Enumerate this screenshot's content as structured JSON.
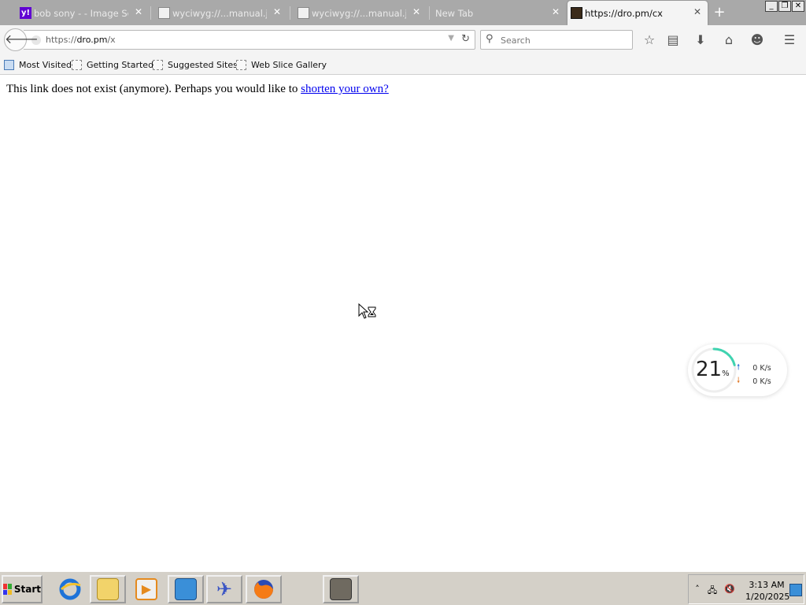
{
  "browser": {
    "tabs": [
      {
        "label": "bob sony - - Image Se…",
        "icon": "yahoo-icon",
        "active": false
      },
      {
        "label": "wyciwyg://...manual.jsp",
        "icon": "document-icon",
        "active": false
      },
      {
        "label": "wyciwyg://...manual.jsp",
        "icon": "document-icon",
        "active": false
      },
      {
        "label": "New Tab",
        "icon": "",
        "active": false
      },
      {
        "label": "https://dro.pm/cx",
        "icon": "dropm-icon",
        "active": true
      }
    ],
    "new_tab_symbol": "+",
    "window_buttons": [
      "_",
      "❐",
      "✕"
    ]
  },
  "navbar": {
    "url_prefix": "https://",
    "url_host": "dro.pm",
    "url_path": "/x",
    "search_placeholder": "Search"
  },
  "bookmarks": [
    {
      "label": "Most Visited"
    },
    {
      "label": "Getting Started"
    },
    {
      "label": "Suggested Sites"
    },
    {
      "label": "Web Slice Gallery"
    }
  ],
  "page": {
    "message": "This link does not exist (anymore). Perhaps you would like to ",
    "link_text": "shorten your own?"
  },
  "netmon": {
    "percent": "21",
    "percent_sign": "%",
    "upload": "0 K/s",
    "download": "0 K/s",
    "ring_fraction": 0.21
  },
  "taskbar": {
    "start_label": "Start",
    "time": "3:13 AM",
    "date": "1/20/2025"
  },
  "colors": {
    "tabstrip": "#a9a9a9",
    "toolbar": "#f4f4f4",
    "link": "#0000ee",
    "taskbar": "#d4d0c8"
  }
}
